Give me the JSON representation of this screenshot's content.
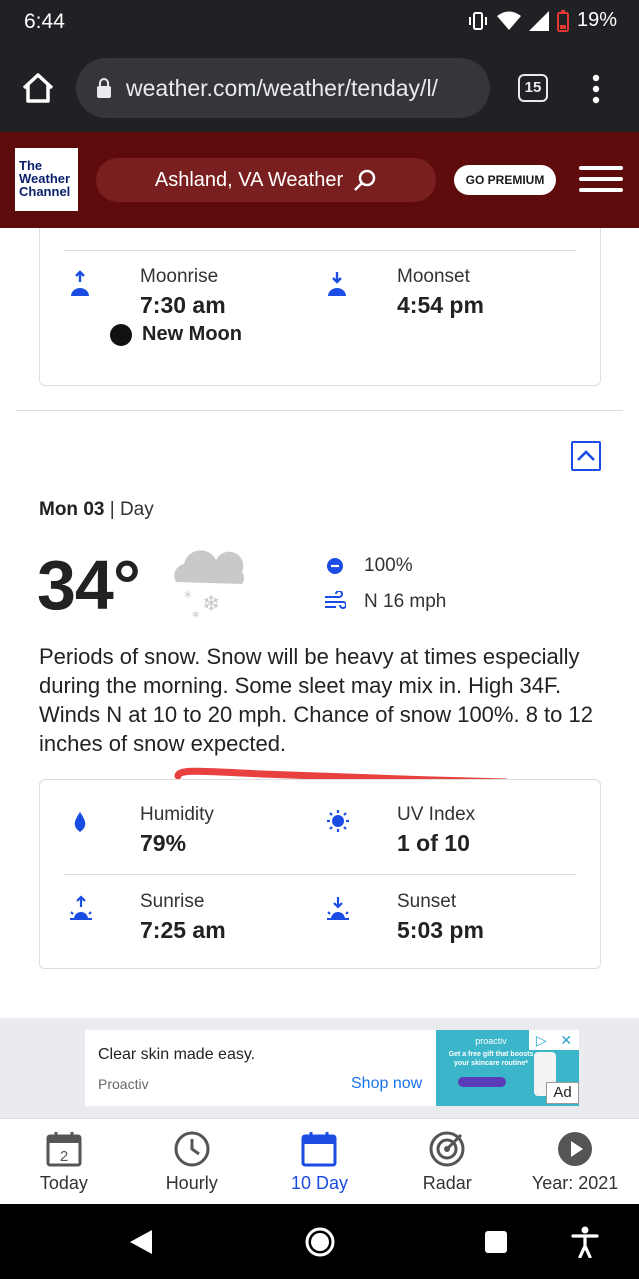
{
  "status_bar": {
    "time": "6:44",
    "battery": "19%"
  },
  "browser": {
    "url": "weather.com/weather/tenday/l/",
    "tab_count": "15"
  },
  "header": {
    "logo_line1": "The",
    "logo_line2": "Weather",
    "logo_line3": "Channel",
    "search_text": "Ashland, VA Weather",
    "premium_label": "GO PREMIUM"
  },
  "moon_card": {
    "moonrise_label": "Moonrise",
    "moonrise_value": "7:30 am",
    "moonset_label": "Moonset",
    "moonset_value": "4:54 pm",
    "phase": "New Moon"
  },
  "day": {
    "date": "Mon 03",
    "separator": " | ",
    "period": "Day",
    "temperature": "34°",
    "condition_icon": "snow-cloud-icon",
    "precip_chance": "100%",
    "wind": "N 16 mph",
    "narrative": "Periods of snow. Snow will be heavy at times especially during the morning. Some sleet may mix in. High 34F. Winds N at 10 to 20 mph. Chance of snow 100%. 8 to 12 inches of snow expected."
  },
  "details": {
    "humidity_label": "Humidity",
    "humidity_value": "79%",
    "uv_label": "UV Index",
    "uv_value": "1 of 10",
    "sunrise_label": "Sunrise",
    "sunrise_value": "7:25 am",
    "sunset_label": "Sunset",
    "sunset_value": "5:03 pm"
  },
  "ad": {
    "headline": "Clear skin made easy.",
    "advertiser": "Proactiv",
    "cta": "Shop now",
    "image_brand": "proactiv",
    "image_text": "Get a free gift that boosts your skincare routine*",
    "label": "Ad"
  },
  "bottom_nav": {
    "today_day": "2",
    "today": "Today",
    "hourly": "Hourly",
    "ten_day": "10 Day",
    "radar": "Radar",
    "year": "Year: 2021"
  },
  "colors": {
    "brand_header": "#5e0b0b",
    "accent_blue": "#1b4de4",
    "annotation_red": "#e8403f"
  }
}
